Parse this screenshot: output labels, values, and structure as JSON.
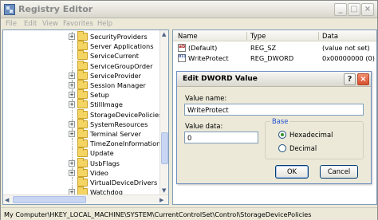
{
  "window": {
    "title": "Registry Editor",
    "buttons": {
      "minimize": "_",
      "maximize": "□",
      "close": "×"
    }
  },
  "menu": [
    "File",
    "Edit",
    "View",
    "Favorites",
    "Help"
  ],
  "tree": {
    "items": [
      {
        "label": "SecurityProviders",
        "expandable": true
      },
      {
        "label": "Server Applications",
        "expandable": false
      },
      {
        "label": "ServiceCurrent",
        "expandable": false
      },
      {
        "label": "ServiceGroupOrder",
        "expandable": false
      },
      {
        "label": "ServiceProvider",
        "expandable": true
      },
      {
        "label": "Session Manager",
        "expandable": true
      },
      {
        "label": "Setup",
        "expandable": true
      },
      {
        "label": "StillImage",
        "expandable": true
      },
      {
        "label": "StorageDevicePolicies",
        "expandable": false
      },
      {
        "label": "SystemResources",
        "expandable": true
      },
      {
        "label": "Terminal Server",
        "expandable": true
      },
      {
        "label": "TimeZoneInformation",
        "expandable": false
      },
      {
        "label": "Update",
        "expandable": false
      },
      {
        "label": "UsbFlags",
        "expandable": true
      },
      {
        "label": "Video",
        "expandable": true
      },
      {
        "label": "VirtualDeviceDrivers",
        "expandable": false
      },
      {
        "label": "Watchdog",
        "expandable": true
      }
    ],
    "expander_symbol": "+"
  },
  "list": {
    "columns": [
      "Name",
      "Type",
      "Data"
    ],
    "rows": [
      {
        "icon": "string-value-icon",
        "name": "(Default)",
        "type": "REG_SZ",
        "data": "(value not set)"
      },
      {
        "icon": "dword-value-icon",
        "name": "WriteProtect",
        "type": "REG_DWORD",
        "data": "0x00000000 (0)"
      }
    ]
  },
  "dialog": {
    "title": "Edit DWORD Value",
    "help_button": "?",
    "close_button": "×",
    "value_name_label": "Value name:",
    "value_name": "WriteProtect",
    "value_data_label": "Value data:",
    "value_data": "0",
    "base_label": "Base",
    "base_options": [
      {
        "label": "Hexadecimal",
        "checked": true
      },
      {
        "label": "Decimal",
        "checked": false
      }
    ],
    "ok_label": "OK",
    "cancel_label": "Cancel"
  },
  "statusbar": {
    "path": "My Computer\\HKEY_LOCAL_MACHINE\\SYSTEM\\CurrentControlSet\\Control\\StorageDevicePolicies"
  },
  "colors": {
    "accent_blue": "#1f4fd0",
    "close_red": "#d8502e"
  }
}
